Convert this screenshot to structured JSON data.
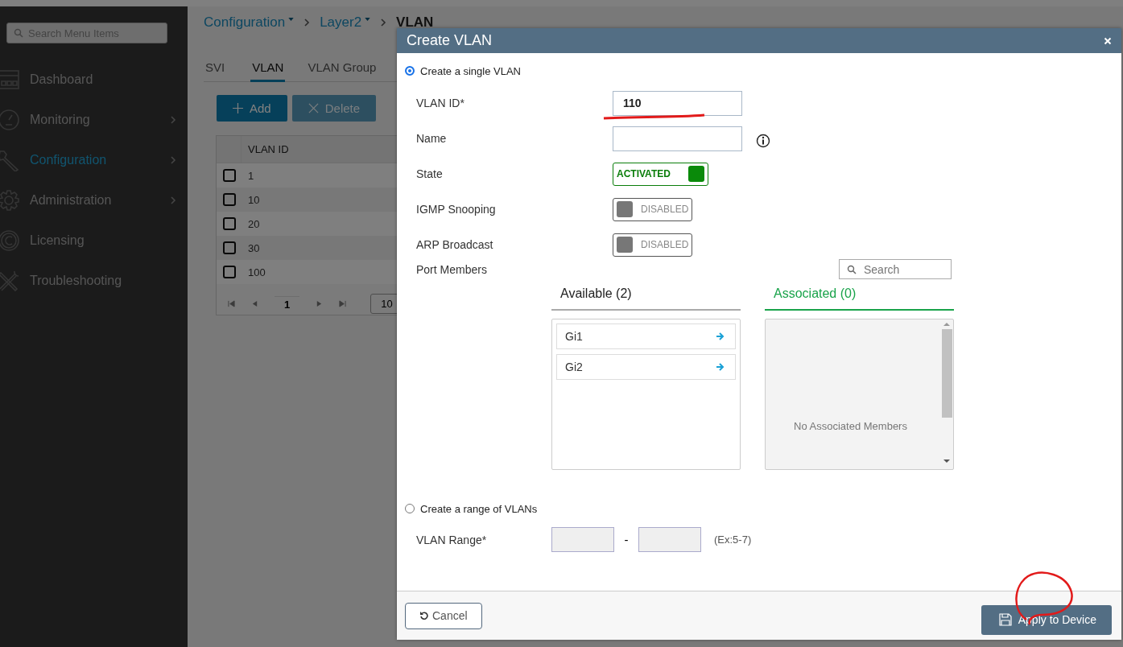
{
  "sidebar": {
    "search": {
      "placeholder": "Search Menu Items"
    },
    "items": [
      {
        "label": "Dashboard",
        "selected": false,
        "submenu": false
      },
      {
        "label": "Monitoring",
        "selected": false,
        "submenu": true
      },
      {
        "label": "Configuration",
        "selected": true,
        "submenu": true
      },
      {
        "label": "Administration",
        "selected": false,
        "submenu": true
      },
      {
        "label": "Licensing",
        "selected": false,
        "submenu": false
      },
      {
        "label": "Troubleshooting",
        "selected": false,
        "submenu": false
      }
    ]
  },
  "breadcrumb": [
    {
      "label": "Configuration",
      "dropdown": true
    },
    {
      "label": "Layer2",
      "dropdown": true
    },
    {
      "label": "VLAN",
      "dropdown": false
    }
  ],
  "tabs": [
    {
      "label": "SVI",
      "selected": false
    },
    {
      "label": "VLAN",
      "selected": true
    },
    {
      "label": "VLAN Group",
      "selected": false
    }
  ],
  "toolbar": [
    {
      "label": "Add",
      "disabled": false
    },
    {
      "label": "Delete",
      "disabled": true
    }
  ],
  "table": {
    "columns": [
      "VLAN ID"
    ],
    "rows": [
      {
        "vlan_id": "1",
        "checked": false
      },
      {
        "vlan_id": "10",
        "checked": false
      },
      {
        "vlan_id": "20",
        "checked": false
      },
      {
        "vlan_id": "30",
        "checked": false
      },
      {
        "vlan_id": "100",
        "checked": false
      }
    ],
    "pagination": {
      "page": "1",
      "page_size": "10"
    }
  },
  "dialog": {
    "title": "Create VLAN",
    "single": {
      "label": "Create a single VLAN",
      "selected": true
    },
    "fields": [
      {
        "kind": "text",
        "label": "VLAN ID*",
        "value": "110"
      },
      {
        "kind": "text",
        "label": "Name",
        "info": true
      },
      {
        "kind": "toggle",
        "label": "State",
        "on": true,
        "text": "ACTIVATED"
      },
      {
        "kind": "toggle",
        "label": "IGMP Snooping",
        "on": false,
        "text": "DISABLED"
      },
      {
        "kind": "toggle",
        "label": "ARP Broadcast",
        "on": false,
        "text": "DISABLED"
      }
    ],
    "port_members": {
      "label": "Port Members",
      "search": {
        "placeholder": "Search"
      },
      "available": {
        "title": "Available (2)",
        "items": [
          "Gi1",
          "Gi2"
        ]
      },
      "associated": {
        "title": "Associated (0)",
        "empty_text": "No Associated Members"
      }
    },
    "range": {
      "label": "Create a range of VLANs",
      "selected": false,
      "field_label": "VLAN Range*",
      "separator": "-",
      "hint": "(Ex:5-7)"
    },
    "buttons": {
      "cancel": "Cancel",
      "apply": "Apply to Device"
    }
  }
}
